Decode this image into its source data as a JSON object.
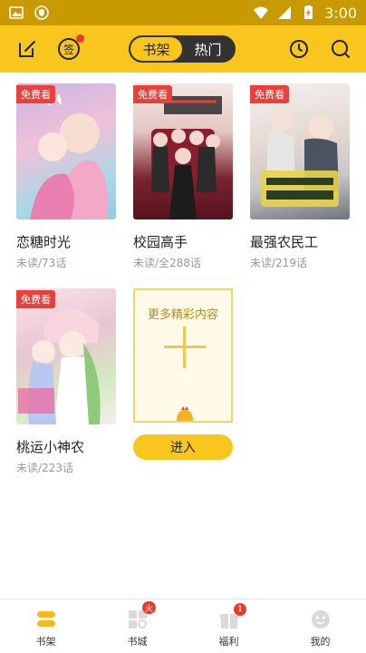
{
  "status_bar": {
    "time": "3:00",
    "left_icons": [
      "image-icon",
      "shield-icon"
    ],
    "right_icons": [
      "wifi-icon",
      "signal-icon",
      "battery-icon"
    ]
  },
  "topbar": {
    "edit_icon": "edit-icon",
    "sign_label": "签",
    "tabs": [
      {
        "label": "书架",
        "active": true
      },
      {
        "label": "热门",
        "active": false
      }
    ],
    "history_icon": "clock-icon",
    "search_icon": "search-icon"
  },
  "books": [
    {
      "title": "恋糖时光",
      "progress": "未读/73话",
      "free_tag": "免费看"
    },
    {
      "title": "校园高手",
      "progress": "未读/全288话",
      "free_tag": "免费看"
    },
    {
      "title": "最强农民工",
      "progress": "未读/219话",
      "free_tag": "免费看"
    },
    {
      "title": "桃运小神农",
      "progress": "未读/223话",
      "free_tag": "免费看"
    }
  ],
  "more_card": {
    "title": "更多精彩内容",
    "button": "进入"
  },
  "bottom_nav": [
    {
      "label": "书架",
      "icon": "bookshelf-icon",
      "active": true
    },
    {
      "label": "书城",
      "icon": "bookstore-icon",
      "badge": "火"
    },
    {
      "label": "福利",
      "icon": "gift-icon",
      "badge": "1"
    },
    {
      "label": "我的",
      "icon": "profile-icon"
    }
  ],
  "colors": {
    "status_bar": "#c99a00",
    "top_bar": "#f9c61d",
    "accent": "#f9c61d",
    "free_tag": "#e8403a",
    "badge": "#e93a2f"
  }
}
